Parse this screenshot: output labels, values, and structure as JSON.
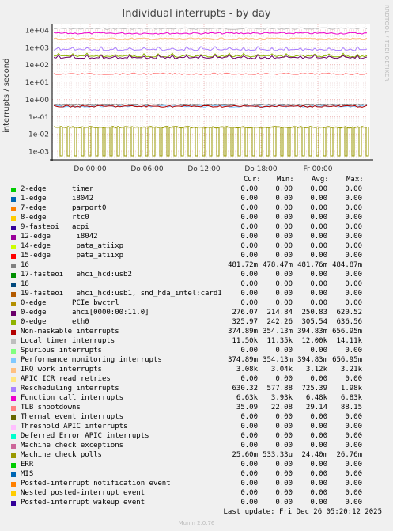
{
  "title": "Individual interrupts - by day",
  "ylabel": "interrupts / second",
  "watermark": "RRDTOOL / TOBI OETIKER",
  "legend_header": {
    "cur": "Cur:",
    "min": "Min:",
    "avg": "Avg:",
    "max": "Max:"
  },
  "last_update": "Last update: Fri Dec 26 05:20:12 2025",
  "munin_version": "Munin 2.0.76",
  "chart_data": {
    "type": "line",
    "title": "Individual interrupts - by day",
    "ylabel": "interrupts / second",
    "yscale": "log",
    "ylim": [
      0.0005,
      20000
    ],
    "y_ticks": [
      "1e-03",
      "1e-02",
      "1e-01",
      "1e+00",
      "1e+01",
      "1e+02",
      "1e+03",
      "1e+04"
    ],
    "x_ticks": [
      "Do 00:00",
      "Do 06:00",
      "Do 12:00",
      "Do 18:00",
      "Fr 00:00"
    ],
    "legend": [
      {
        "name": "2-edge      timer",
        "color": "#00cc00",
        "cur": "0.00",
        "min": "0.00",
        "avg": "0.00",
        "max": "0.00"
      },
      {
        "name": "1-edge      i8042",
        "color": "#0066b3",
        "cur": "0.00",
        "min": "0.00",
        "avg": "0.00",
        "max": "0.00"
      },
      {
        "name": "7-edge      parport0",
        "color": "#ff8000",
        "cur": "0.00",
        "min": "0.00",
        "avg": "0.00",
        "max": "0.00"
      },
      {
        "name": "8-edge      rtc0",
        "color": "#ffcc00",
        "cur": "0.00",
        "min": "0.00",
        "avg": "0.00",
        "max": "0.00"
      },
      {
        "name": "9-fasteoi   acpi",
        "color": "#330099",
        "cur": "0.00",
        "min": "0.00",
        "avg": "0.00",
        "max": "0.00"
      },
      {
        "name": "12-edge      i8042",
        "color": "#990099",
        "cur": "0.00",
        "min": "0.00",
        "avg": "0.00",
        "max": "0.00"
      },
      {
        "name": "14-edge      pata_atiixp",
        "color": "#ccff00",
        "cur": "0.00",
        "min": "0.00",
        "avg": "0.00",
        "max": "0.00"
      },
      {
        "name": "15-edge      pata_atiixp",
        "color": "#ff0000",
        "cur": "0.00",
        "min": "0.00",
        "avg": "0.00",
        "max": "0.00"
      },
      {
        "name": "16",
        "color": "#808080",
        "cur": "481.72m",
        "min": "478.47m",
        "avg": "481.76m",
        "max": "484.87m"
      },
      {
        "name": "17-fasteoi   ehci_hcd:usb2",
        "color": "#008f00",
        "cur": "0.00",
        "min": "0.00",
        "avg": "0.00",
        "max": "0.00"
      },
      {
        "name": "18",
        "color": "#00487d",
        "cur": "0.00",
        "min": "0.00",
        "avg": "0.00",
        "max": "0.00"
      },
      {
        "name": "19-fasteoi   ehci_hcd:usb1, snd_hda_intel:card1",
        "color": "#b35a00",
        "cur": "0.00",
        "min": "0.00",
        "avg": "0.00",
        "max": "0.00"
      },
      {
        "name": "0-edge      PCIe bwctrl",
        "color": "#b38f00",
        "cur": "0.00",
        "min": "0.00",
        "avg": "0.00",
        "max": "0.00"
      },
      {
        "name": "0-edge      ahci[0000:00:11.0]",
        "color": "#6b006b",
        "cur": "276.07",
        "min": "214.84",
        "avg": "250.83",
        "max": "620.52"
      },
      {
        "name": "0-edge      eth0",
        "color": "#8fb300",
        "cur": "325.97",
        "min": "242.26",
        "avg": "305.54",
        "max": "636.56"
      },
      {
        "name": "Non-maskable interrupts",
        "color": "#b30000",
        "cur": "374.89m",
        "min": "354.13m",
        "avg": "394.83m",
        "max": "656.95m"
      },
      {
        "name": "Local timer interrupts",
        "color": "#bebebe",
        "cur": "11.50k",
        "min": "11.35k",
        "avg": "12.00k",
        "max": "14.11k"
      },
      {
        "name": "Spurious interrupts",
        "color": "#80ff80",
        "cur": "0.00",
        "min": "0.00",
        "avg": "0.00",
        "max": "0.00"
      },
      {
        "name": "Performance monitoring interrupts",
        "color": "#80c9ff",
        "cur": "374.89m",
        "min": "354.13m",
        "avg": "394.83m",
        "max": "656.95m"
      },
      {
        "name": "IRQ work interrupts",
        "color": "#ffc080",
        "cur": "3.08k",
        "min": "3.04k",
        "avg": "3.12k",
        "max": "3.21k"
      },
      {
        "name": "APIC ICR read retries",
        "color": "#ffe680",
        "cur": "0.00",
        "min": "0.00",
        "avg": "0.00",
        "max": "0.00"
      },
      {
        "name": "Rescheduling interrupts",
        "color": "#aa80ff",
        "cur": "630.32",
        "min": "577.88",
        "avg": "725.39",
        "max": "1.98k"
      },
      {
        "name": "Function call interrupts",
        "color": "#ee00cc",
        "cur": "6.63k",
        "min": "3.93k",
        "avg": "6.48k",
        "max": "6.83k"
      },
      {
        "name": "TLB shootdowns",
        "color": "#ff8080",
        "cur": "35.09",
        "min": "22.08",
        "avg": "29.14",
        "max": "88.15"
      },
      {
        "name": "Thermal event interrupts",
        "color": "#666600",
        "cur": "0.00",
        "min": "0.00",
        "avg": "0.00",
        "max": "0.00"
      },
      {
        "name": "Threshold APIC interrupts",
        "color": "#ffbfff",
        "cur": "0.00",
        "min": "0.00",
        "avg": "0.00",
        "max": "0.00"
      },
      {
        "name": "Deferred Error APIC interrupts",
        "color": "#00ffcc",
        "cur": "0.00",
        "min": "0.00",
        "avg": "0.00",
        "max": "0.00"
      },
      {
        "name": "Machine check exceptions",
        "color": "#cc6699",
        "cur": "0.00",
        "min": "0.00",
        "avg": "0.00",
        "max": "0.00"
      },
      {
        "name": "Machine check polls",
        "color": "#999900",
        "cur": "25.60m",
        "min": "533.33u",
        "avg": "24.40m",
        "max": "26.76m"
      },
      {
        "name": "ERR",
        "color": "#00cc00",
        "cur": "0.00",
        "min": "0.00",
        "avg": "0.00",
        "max": "0.00"
      },
      {
        "name": "MIS",
        "color": "#0066b3",
        "cur": "0.00",
        "min": "0.00",
        "avg": "0.00",
        "max": "0.00"
      },
      {
        "name": "Posted-interrupt notification event",
        "color": "#ff8000",
        "cur": "0.00",
        "min": "0.00",
        "avg": "0.00",
        "max": "0.00"
      },
      {
        "name": "Nested posted-interrupt event",
        "color": "#ffcc00",
        "cur": "0.00",
        "min": "0.00",
        "avg": "0.00",
        "max": "0.00"
      },
      {
        "name": "Posted-interrupt wakeup event",
        "color": "#330099",
        "cur": "0.00",
        "min": "0.00",
        "avg": "0.00",
        "max": "0.00"
      }
    ],
    "plotted_levels": [
      {
        "series": "Local timer interrupts",
        "value": 12000,
        "color": "#bebebe"
      },
      {
        "series": "Function call interrupts",
        "value": 6480,
        "color": "#ee00cc"
      },
      {
        "series": "IRQ work interrupts",
        "value": 3120,
        "color": "#ffc080"
      },
      {
        "series": "Rescheduling interrupts",
        "value": 725.39,
        "color": "#aa80ff"
      },
      {
        "series": "0-edge      eth0",
        "value": 305.54,
        "color": "#8fb300"
      },
      {
        "series": "0-edge      ahci[0000:00:11.0]",
        "value": 250.83,
        "color": "#6b006b"
      },
      {
        "series": "TLB shootdowns",
        "value": 29.14,
        "color": "#ff8080"
      },
      {
        "series": "16",
        "value": 0.48176,
        "color": "#808080"
      },
      {
        "series": "Performance monitoring interrupts",
        "value": 0.39483,
        "color": "#80c9ff"
      },
      {
        "series": "Non-maskable interrupts",
        "value": 0.39483,
        "color": "#b30000"
      },
      {
        "series": "Machine check polls",
        "value": 0.0244,
        "color": "#999900"
      }
    ]
  }
}
